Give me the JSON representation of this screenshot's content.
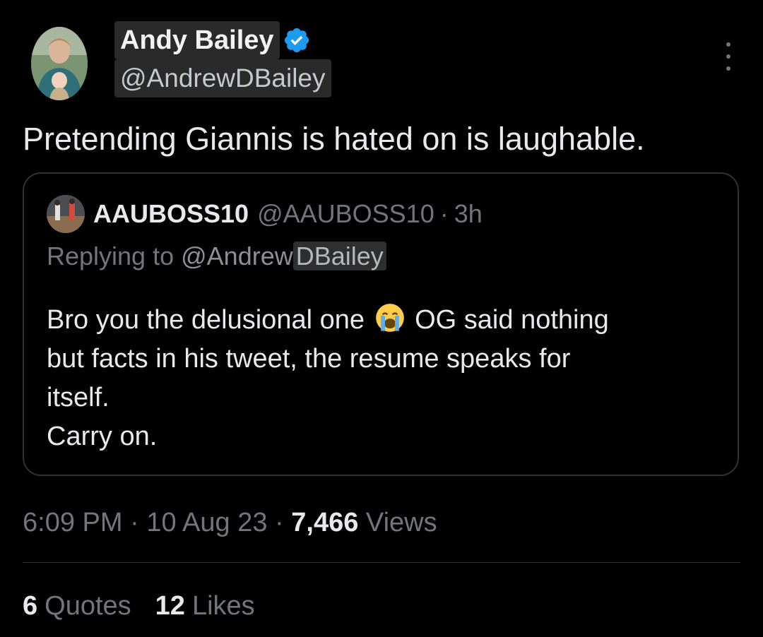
{
  "author": {
    "display_name": "Andy Bailey",
    "handle": "@AndrewDBailey",
    "verified_icon": "verified-badge-icon",
    "verified_color": "#1d9bf0"
  },
  "tweet": {
    "text": "Pretending Giannis is hated on is laughable."
  },
  "quoted": {
    "display_name": "AAUBOSS10",
    "handle": "@AAUBOSS10",
    "separator": "·",
    "time": "3h",
    "replying_prefix": "Replying to ",
    "replying_handle_part1": "@Andrew",
    "replying_handle_part2": "DBailey",
    "body_line1_a": "Bro you the delusional one",
    "body_line1_b": "OG said nothing",
    "body_line2": "but facts in his tweet, the resume speaks for",
    "body_line3": "itself.",
    "body_line4": "Carry on.",
    "emoji": "loudly-crying-face"
  },
  "meta": {
    "time": "6:09 PM",
    "sep1": "·",
    "date": "10 Aug 23",
    "sep2": "·",
    "views_count": "7,466",
    "views_label": "Views"
  },
  "stats": {
    "quotes_count": "6",
    "quotes_label": "Quotes",
    "likes_count": "12",
    "likes_label": "Likes"
  },
  "colors": {
    "background": "#000000",
    "text_primary": "#e7e9ea",
    "text_secondary": "#71767b",
    "border": "#2f3336"
  }
}
